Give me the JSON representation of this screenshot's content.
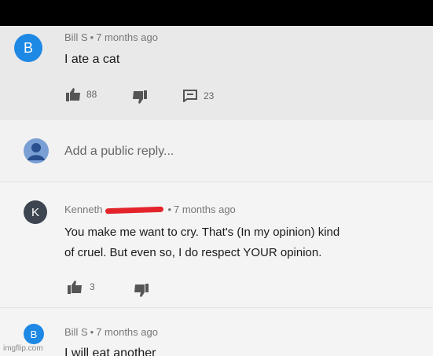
{
  "comments": [
    {
      "avatar_letter": "B",
      "author": "Bill S",
      "time": "7 months ago",
      "text": "I ate a cat",
      "likes": "88",
      "replies": "23",
      "avatar_color": "#1e88e5"
    },
    {
      "avatar_letter": "K",
      "author": "Kenneth",
      "time": "7 months ago",
      "text_line1": "You make me want to cry. That's (In my opinion) kind",
      "text_line2": "of cruel. But even so, I do respect YOUR opinion.",
      "likes": "3",
      "avatar_color": "#3d4650"
    },
    {
      "avatar_letter": "B",
      "author": "Bill S",
      "time": "7 months ago",
      "text": "I will eat another",
      "avatar_color": "#1e88e5"
    }
  ],
  "reply_box": {
    "placeholder": "Add a public reply...",
    "avatar_color": "#7a9fd4"
  },
  "separator": "•",
  "watermark": "imgflip.com",
  "colors": {
    "redaction": "#e4242b",
    "icon": "#555555"
  }
}
